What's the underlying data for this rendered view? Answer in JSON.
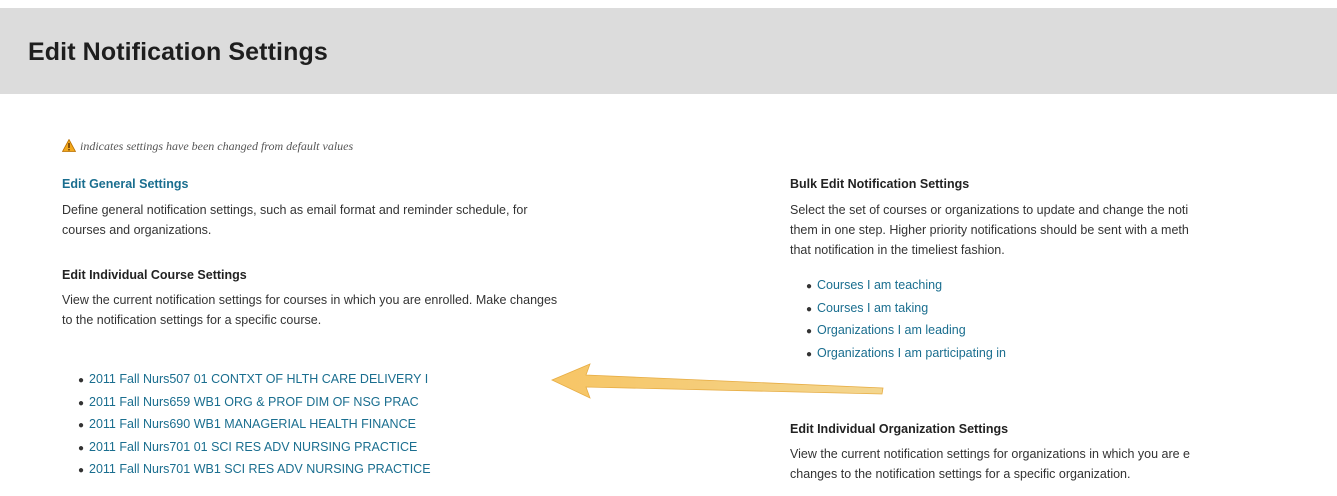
{
  "header": {
    "title": "Edit Notification Settings"
  },
  "legend": {
    "text": "indicates settings have been changed from default values",
    "icon": "warning-icon"
  },
  "general": {
    "link": "Edit General Settings",
    "desc1": "Define general notification settings, such as email format and reminder schedule, for",
    "desc2": "courses and organizations."
  },
  "individual_course": {
    "title": "Edit Individual Course Settings",
    "desc1": "View the current notification settings for courses in which you are enrolled. Make changes",
    "desc2": "to the notification settings for a specific course.",
    "courses": [
      "2011 Fall Nurs507 01 CONTXT OF HLTH CARE DELIVERY I",
      "2011 Fall Nurs659 WB1 ORG & PROF DIM OF NSG PRAC",
      "2011 Fall Nurs690 WB1 MANAGERIAL HEALTH FINANCE",
      "2011 Fall Nurs701 01 SCI RES ADV NURSING PRACTICE",
      "2011 Fall Nurs701 WB1 SCI RES ADV NURSING PRACTICE"
    ]
  },
  "bulk": {
    "title": "Bulk Edit Notification Settings",
    "desc1": "Select the set of courses or organizations to update and change the noti",
    "desc2": "them in one step. Higher priority notifications should be sent with a meth",
    "desc3": "that notification in the timeliest fashion.",
    "links": [
      "Courses I am teaching",
      "Courses I am taking",
      "Organizations I am leading",
      "Organizations I am participating in"
    ]
  },
  "individual_org": {
    "title": "Edit Individual Organization Settings",
    "desc1": "View the current notification settings for organizations in which you are e",
    "desc2": "changes to the notification settings for a specific organization."
  },
  "colors": {
    "link": "#1a6e8f",
    "header_bg": "#dcdcdc",
    "arrow": "#f5c05a"
  }
}
